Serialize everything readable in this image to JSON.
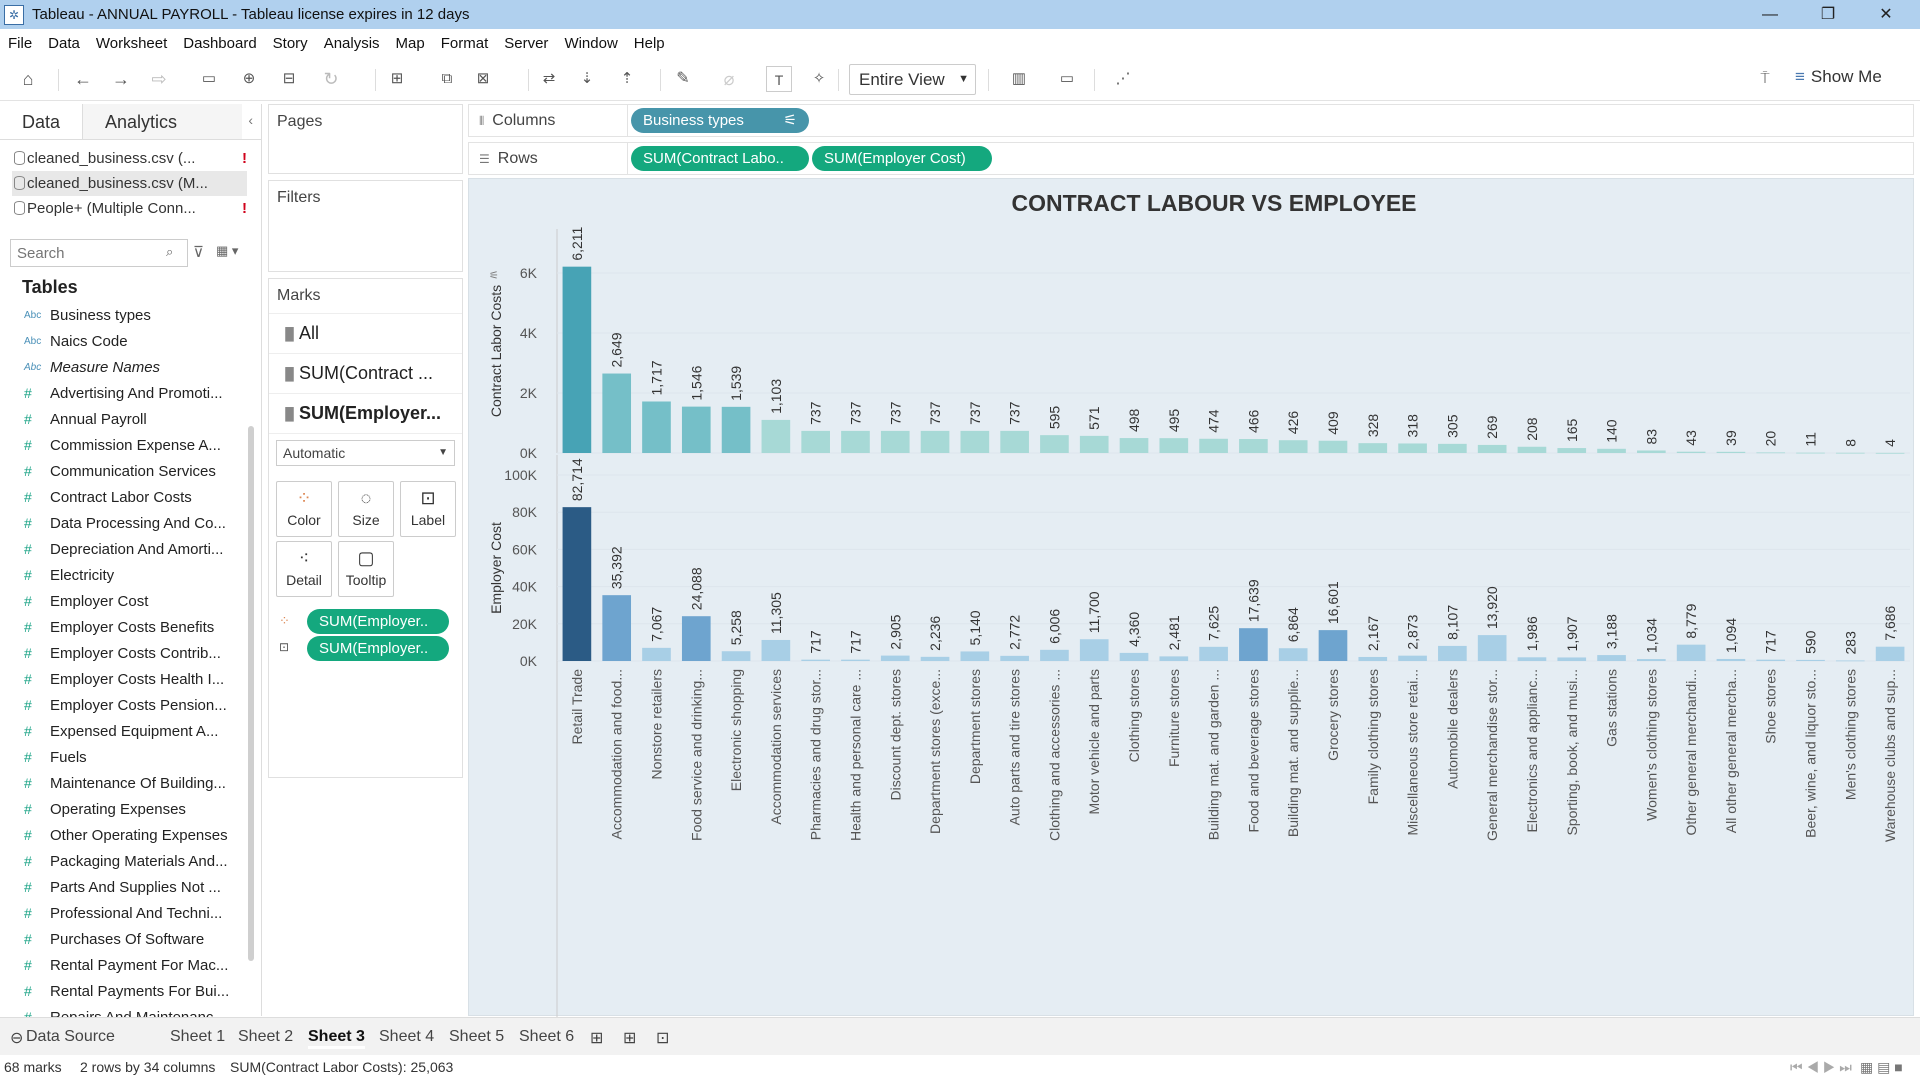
{
  "window": {
    "title": "Tableau - ANNUAL PAYROLL - Tableau license expires in 12 days"
  },
  "menu": [
    "File",
    "Data",
    "Worksheet",
    "Dashboard",
    "Story",
    "Analysis",
    "Map",
    "Format",
    "Server",
    "Window",
    "Help"
  ],
  "toolbar": {
    "view_select": "Entire View",
    "show_me": "Show Me"
  },
  "data_pane": {
    "tab_data": "Data",
    "tab_analytics": "Analytics",
    "datasources": [
      {
        "label": "cleaned_business.csv (...",
        "error": "!"
      },
      {
        "label": "cleaned_business.csv (M...",
        "error": ""
      },
      {
        "label": "People+ (Multiple Conn...",
        "error": "!"
      }
    ],
    "search_placeholder": "Search",
    "tables_header": "Tables",
    "dim_type": "Abc",
    "fields": [
      "Business types",
      "Naics Code",
      "Measure Names",
      "Advertising And Promoti...",
      "Annual Payroll",
      "Commission Expense A...",
      "Communication Services",
      "Contract Labor Costs",
      "Data Processing And Co...",
      "Depreciation And Amorti...",
      "Electricity",
      "Employer Cost",
      "Employer Costs Benefits",
      "Employer Costs Contrib...",
      "Employer Costs Health I...",
      "Employer Costs Pension...",
      "Expensed Equipment A...",
      "Fuels",
      "Maintenance Of Building...",
      "Operating Expenses",
      "Other Operating Expenses",
      "Packaging Materials And...",
      "Parts And Supplies Not ...",
      "Professional And Techni...",
      "Purchases Of Software",
      "Rental Payment For Mac...",
      "Rental Payments For Bui...",
      "Repairs And Maintenanc..."
    ]
  },
  "pages": {
    "title": "Pages"
  },
  "filters": {
    "title": "Filters"
  },
  "marks": {
    "title": "Marks",
    "rows": [
      "All",
      "SUM(Contract ...",
      "SUM(Employer..."
    ],
    "mark_type": "Automatic",
    "buttons": [
      "Color",
      "Size",
      "Label",
      "Detail",
      "Tooltip"
    ],
    "pills": [
      "SUM(Employer..",
      "SUM(Employer.."
    ]
  },
  "columns": {
    "label": "Columns",
    "pill": "Business types"
  },
  "rows": {
    "label": "Rows",
    "pills": [
      "SUM(Contract Labo..",
      "SUM(Employer Cost)"
    ]
  },
  "chart_data": {
    "type": "bar",
    "title": "CONTRACT LABOUR VS EMPLOYEE",
    "categories": [
      "Retail Trade",
      "Accommodation and food...",
      "Nonstore retailers",
      "Food service and drinking...",
      "Electronic shopping",
      "Accommodation services",
      "Pharmacies and drug stor...",
      "Health and personal care ...",
      "Discount dept. stores",
      "Department stores (exce...",
      "Department stores",
      "Auto parts and tire stores",
      "Clothing and accessories ...",
      "Motor vehicle and parts",
      "Clothing stores",
      "Furniture stores",
      "Building mat. and garden ...",
      "Food and beverage stores",
      "Building mat. and supplie...",
      "Grocery stores",
      "Family clothing stores",
      "Miscellaneous store retai...",
      "Automobile dealers",
      "General merchandise stor...",
      "Electronics and applianc...",
      "Sporting, book, and musi...",
      "Gas stations",
      "Women's clothing stores",
      "Other general merchandi...",
      "All other general mercha...",
      "Shoe stores",
      "Beer, wine, and liquor sto...",
      "Men's clothing stores",
      "Warehouse clubs and sup..."
    ],
    "series": [
      {
        "name": "Contract Labor Costs",
        "values": [
          6211,
          2649,
          1717,
          1546,
          1539,
          1103,
          737,
          737,
          737,
          737,
          737,
          737,
          595,
          571,
          498,
          495,
          474,
          466,
          426,
          409,
          328,
          318,
          305,
          269,
          208,
          165,
          140,
          83,
          43,
          39,
          20,
          11,
          8,
          4
        ],
        "labels": [
          "6,211",
          "2,649",
          "1,717",
          "1,546",
          "1,539",
          "1,103",
          "737",
          "737",
          "737",
          "737",
          "737",
          "737",
          "595",
          "571",
          "498",
          "495",
          "474",
          "466",
          "426",
          "409",
          "328",
          "318",
          "305",
          "269",
          "208",
          "165",
          "140",
          "83",
          "43",
          "39",
          "20",
          "11",
          "8",
          "4"
        ],
        "ylabel": "Contract Labor Costs",
        "yticks": [
          "0K",
          "2K",
          "4K",
          "6K"
        ],
        "ylim": [
          0,
          6800
        ]
      },
      {
        "name": "Employer Cost",
        "values": [
          82714,
          35392,
          7067,
          24088,
          5258,
          11305,
          717,
          717,
          2905,
          2236,
          5140,
          2772,
          6006,
          11700,
          4360,
          2481,
          7625,
          17639,
          6864,
          16601,
          2167,
          2873,
          8107,
          13920,
          1986,
          1907,
          3188,
          1034,
          8779,
          1094,
          717,
          590,
          283,
          7686
        ],
        "labels": [
          "82,714",
          "35,392",
          "7,067",
          "24,088",
          "5,258",
          "11,305",
          "717",
          "717",
          "2,905",
          "2,236",
          "5,140",
          "2,772",
          "6,006",
          "11,700",
          "4,360",
          "2,481",
          "7,625",
          "17,639",
          "6,864",
          "16,601",
          "2,167",
          "2,873",
          "8,107",
          "13,920",
          "1,986",
          "1,907",
          "3,188",
          "1,034",
          "8,779",
          "1,094",
          "717",
          "590",
          "283",
          "7,686"
        ],
        "ylabel": "Employer Cost",
        "yticks": [
          "0K",
          "20K",
          "40K",
          "60K",
          "80K",
          "100K"
        ],
        "ylim": [
          0,
          100000
        ]
      }
    ],
    "colors": {
      "dark": "#2b5b85",
      "mid": "#6ea4cf",
      "light": "#a8cfe6",
      "teal_dark": "#47a3b5",
      "teal": "#75bfc8",
      "teal_light": "#a7d9d6"
    }
  },
  "sheets": {
    "datasource": "Data Source",
    "tabs": [
      "Sheet 1",
      "Sheet 2",
      "Sheet 3",
      "Sheet 4",
      "Sheet 5",
      "Sheet 6"
    ]
  },
  "status": {
    "marks": "68 marks",
    "dims": "2 rows by 34 columns",
    "sum": "SUM(Contract Labor Costs): 25,063"
  }
}
